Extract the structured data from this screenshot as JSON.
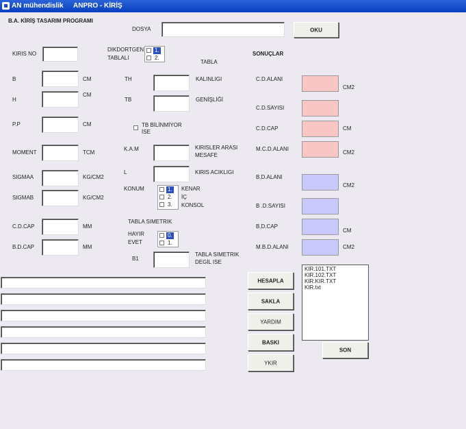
{
  "window": {
    "app": "AN mühendislik",
    "title": "ANPRO - KİRİŞ"
  },
  "header": {
    "program_title": "B.A. KİRİŞ TASARIM PROGRAMI",
    "dosya_label": "DOSYA",
    "dosya_value": "",
    "oku_button": "OKU"
  },
  "left": {
    "kiris_no": "KIRIS NO",
    "b": "B",
    "h": "H",
    "pp": "P.P",
    "moment": "MOMENT",
    "sigmaa": "SIGMAA",
    "sigmab": "SIGMAB",
    "cd_cap": "C.D.CAP",
    "bd_cap": "B.D.CAP",
    "unit_cm": "CM",
    "unit_tcm": "TCM",
    "unit_kgcm2": "KG/CM2",
    "unit_mm": "MM"
  },
  "middle": {
    "dikdortgen_1": "DIKDORTGEN",
    "dikdortgen_2": "TABLALI",
    "shape_options": [
      "1.",
      "2."
    ],
    "tabla": "TABLA",
    "th": "TH",
    "tb": "TB",
    "kalinligi": "KALINLIGI",
    "genisligi": "GENİŞLİĞİ",
    "tb_bilinmiyor_1": "TB BİLİNMİYOR",
    "tb_bilinmiyor_2": "İSE",
    "kam": "K.A.M",
    "kirisler_1": "KIRISLER ARASI",
    "kirisler_2": "MESAFE",
    "l": "L",
    "kiris_acikligi": "KIRIS ACIKLIGI",
    "konum": "KONUM",
    "konum_options": [
      "1.",
      "2.",
      "3."
    ],
    "kenar": "KENAR",
    "ic": "İÇ",
    "konsol": "KONSOL",
    "tabla_simetrik": "TABLA SIMETRIK",
    "hayir": "HAYIR",
    "evet": "EVET",
    "sym_options": [
      "0.",
      "1."
    ],
    "b1": "B1",
    "degil_1": "TABLA SIMETRIK",
    "degil_2": "DEGİL ISE"
  },
  "results": {
    "heading": "SONUÇLAR",
    "cd_alani": "C.D.ALANI",
    "cd_sayisi": "C.D.SAYISI",
    "cd_cap": "C.D.CAP",
    "mcd_alani": "M.C.D.ALANI",
    "bd_alani": "B.D.ALANI",
    "bd_sayisi": "B .D.SAYISI",
    "bd_cap": "B.D.CAP",
    "mbd_alani": "M.B.D.ALANI",
    "unit_cm2": "CM2",
    "unit_cm": "CM"
  },
  "buttons": {
    "hesapla": "HESAPLA",
    "sakla": "SAKLA",
    "yardim": "YARDIM",
    "baski": "BASKI",
    "ykir": "YKIR",
    "son": "SON"
  },
  "files": [
    "KIR.101.TXT",
    "KIR.102.TXT",
    "KIR.KIR.TXT",
    "KIR.txt"
  ]
}
